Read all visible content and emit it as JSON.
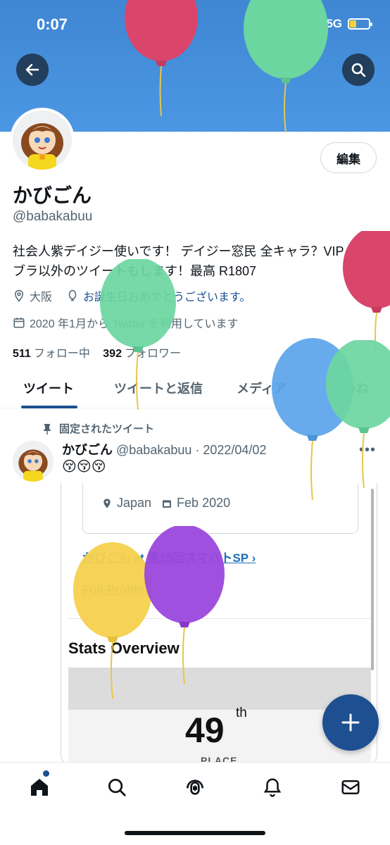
{
  "status_bar": {
    "time": "0:07",
    "network": "5G",
    "battery_level": 0.35
  },
  "header": {
    "back_icon": "arrow-left-icon",
    "search_icon": "search-icon"
  },
  "profile": {
    "name": "かびごん",
    "handle": "@babakabuu",
    "edit_label": "編集",
    "bio_line1": "社会人紫デイジー使いです！ デイジー窓民 全キャラ？VIP スマ",
    "bio_line2": "ブラ以外のツイートもします！最高 R1807",
    "location": "大阪",
    "birthday": "お誕生日おめでとうございます。",
    "joined": "2020 年1月から Twitter を利用しています",
    "following_count": "511",
    "following_label": "フォロー中",
    "followers_count": "392",
    "followers_label": "フォロワー"
  },
  "tabs": [
    {
      "label": "ツイート",
      "active": true
    },
    {
      "label": "ツイートと返信",
      "active": false
    },
    {
      "label": "メディア",
      "active": false
    },
    {
      "label": "いいね",
      "active": false
    }
  ],
  "pinned_tweet": {
    "pinned_label": "固定されたツイート",
    "name": "かびごん",
    "handle_date": "@babakabuu · 2022/04/02",
    "more": "•••",
    "emojis": "😚😚😚",
    "card": {
      "location": "Japan",
      "date": "Feb 2020",
      "event_link": "かびごん at 第25回スマバトSP",
      "full_profile": "Full Profile",
      "stats_title": "Stats Overview",
      "rank": "49",
      "rank_suffix": "th",
      "rank_label": "PLACE"
    }
  },
  "fab": {
    "icon": "plus-icon"
  },
  "bottom_nav": [
    "home-icon",
    "search-icon",
    "spaces-icon",
    "bell-icon",
    "mail-icon"
  ],
  "colors": {
    "banner": "#4b97e3",
    "accent": "#1d4f91",
    "balloon_red": "#d9456b",
    "balloon_green": "#6bd6a0",
    "balloon_blue": "#5aa4ea",
    "balloon_yellow": "#f5d14e",
    "balloon_purple": "#9b47dc"
  }
}
